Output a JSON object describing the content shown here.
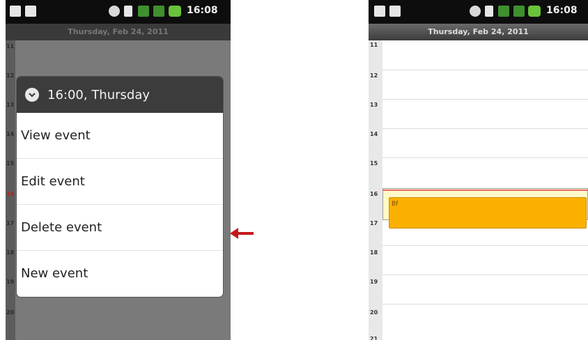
{
  "status_bar": {
    "time": "16:08"
  },
  "date_header": "Thursday, Feb 24, 2011",
  "left_screen": {
    "context_menu": {
      "title": "16:00, Thursday",
      "items": [
        {
          "label": "View event"
        },
        {
          "label": "Edit event"
        },
        {
          "label": "Delete event"
        },
        {
          "label": "New event"
        }
      ]
    },
    "hour_labels": [
      "11",
      "12",
      "13",
      "14",
      "15",
      "16",
      "17",
      "18",
      "19",
      "20"
    ]
  },
  "right_screen": {
    "hour_labels": [
      "11",
      "12",
      "13",
      "14",
      "15",
      "16",
      "17",
      "18",
      "19",
      "20",
      "21"
    ],
    "event": {
      "title": "Bf"
    }
  },
  "colors": {
    "event_fill": "#fbb000",
    "arrow": "#c41a1a",
    "current_hour": "#b52020"
  }
}
